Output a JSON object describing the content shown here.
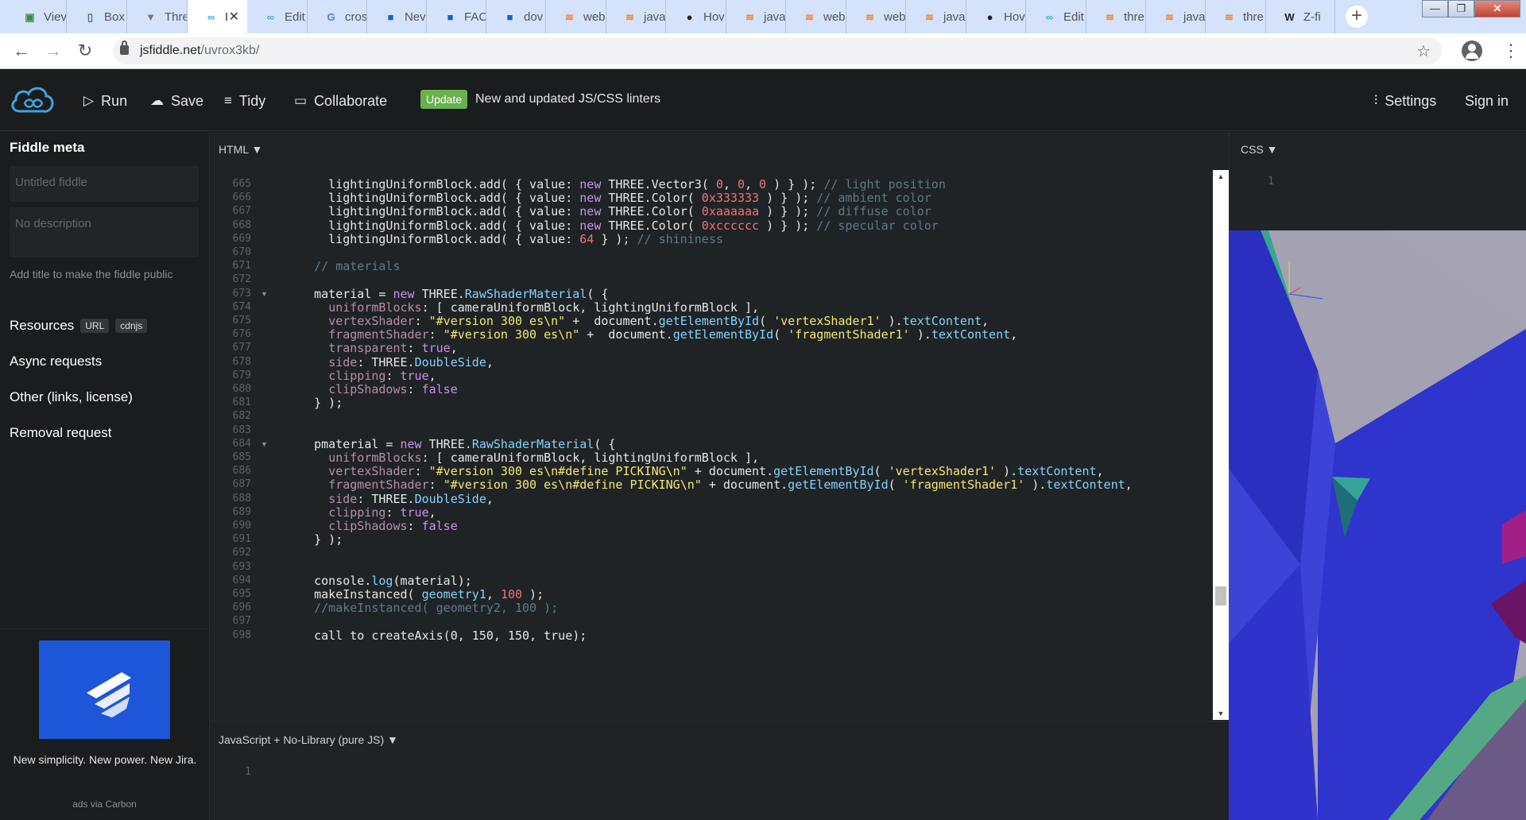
{
  "browser": {
    "tabs": [
      {
        "label": "Viev",
        "icon": "tab-app-icon"
      },
      {
        "label": "Box",
        "icon": "tab-doc-icon"
      },
      {
        "label": "Thre",
        "icon": "tab-triangle-icon"
      },
      {
        "label": "I",
        "icon": "tab-jsfiddle-icon",
        "active": true
      },
      {
        "label": "Edit",
        "icon": "tab-jsfiddle-icon"
      },
      {
        "label": "cros",
        "icon": "tab-google-icon"
      },
      {
        "label": "Nev",
        "icon": "tab-blue-icon"
      },
      {
        "label": "FAC",
        "icon": "tab-blue-icon"
      },
      {
        "label": "dov",
        "icon": "tab-blue-icon"
      },
      {
        "label": "web",
        "icon": "tab-stackoverflow-icon"
      },
      {
        "label": "java",
        "icon": "tab-stackoverflow-icon"
      },
      {
        "label": "Hov",
        "icon": "tab-github-icon"
      },
      {
        "label": "java",
        "icon": "tab-stackoverflow-icon"
      },
      {
        "label": "web",
        "icon": "tab-stackoverflow-icon"
      },
      {
        "label": "web",
        "icon": "tab-stackoverflow-icon"
      },
      {
        "label": "java",
        "icon": "tab-stackoverflow-icon"
      },
      {
        "label": "Hov",
        "icon": "tab-github-icon"
      },
      {
        "label": "Edit",
        "icon": "tab-jsfiddle-icon"
      },
      {
        "label": "thre",
        "icon": "tab-stackoverflow-icon"
      },
      {
        "label": "java",
        "icon": "tab-stackoverflow-icon"
      },
      {
        "label": "thre",
        "icon": "tab-stackoverflow-icon"
      },
      {
        "label": "Z-fi",
        "icon": "tab-wikipedia-icon"
      }
    ],
    "url_domain": "jsfiddle.net",
    "url_path": "/uvrox3kb/"
  },
  "header": {
    "run": "Run",
    "save": "Save",
    "tidy": "Tidy",
    "collaborate": "Collaborate",
    "update_badge": "Update",
    "update_text": "New and updated JS/CSS linters",
    "settings": "Settings",
    "sign_in": "Sign in"
  },
  "sidebar": {
    "title": "Fiddle meta",
    "title_placeholder": "Untitled fiddle",
    "description_placeholder": "No description",
    "hint": "Add title to make the fiddle public",
    "resources": "Resources",
    "resource_badges": [
      "URL",
      "cdnjs"
    ],
    "async": "Async requests",
    "other": "Other (links, license)",
    "removal": "Removal request",
    "ad_text": "New simplicity. New power. New Jira.",
    "ad_via": "ads via Carbon"
  },
  "html_panel": {
    "label": "HTML ▼",
    "first_line": 665,
    "folds": [
      673,
      684
    ],
    "lines": [
      [
        [
          "      lightingUniformBlock.add( { value: ",
          "p"
        ],
        [
          "new ",
          "k"
        ],
        [
          "THREE.Vector3( ",
          "p"
        ],
        [
          "0",
          "n"
        ],
        [
          ", ",
          "p"
        ],
        [
          "0",
          "n"
        ],
        [
          ", ",
          "p"
        ],
        [
          "0",
          "n"
        ],
        [
          " ) } ); ",
          "p"
        ],
        [
          "// light position",
          "c"
        ]
      ],
      [
        [
          "      lightingUniformBlock.add( { value: ",
          "p"
        ],
        [
          "new ",
          "k"
        ],
        [
          "THREE.Color( ",
          "p"
        ],
        [
          "0x333333",
          "n"
        ],
        [
          " ) } ); ",
          "p"
        ],
        [
          "// ambient color",
          "c"
        ]
      ],
      [
        [
          "      lightingUniformBlock.add( { value: ",
          "p"
        ],
        [
          "new ",
          "k"
        ],
        [
          "THREE.Color( ",
          "p"
        ],
        [
          "0xaaaaaa",
          "n"
        ],
        [
          " ) } ); ",
          "p"
        ],
        [
          "// diffuse color",
          "c"
        ]
      ],
      [
        [
          "      lightingUniformBlock.add( { value: ",
          "p"
        ],
        [
          "new ",
          "k"
        ],
        [
          "THREE.Color( ",
          "p"
        ],
        [
          "0xcccccc",
          "n"
        ],
        [
          " ) } ); ",
          "p"
        ],
        [
          "// specular color",
          "c"
        ]
      ],
      [
        [
          "      lightingUniformBlock.add( { value: ",
          "p"
        ],
        [
          "64",
          "n"
        ],
        [
          " } ); ",
          "p"
        ],
        [
          "// shininess",
          "c"
        ]
      ],
      [],
      [
        [
          "    // materials",
          "c"
        ]
      ],
      [],
      [
        [
          "    material = ",
          "p"
        ],
        [
          "new ",
          "k"
        ],
        [
          "THREE.",
          "p"
        ],
        [
          "RawShaderMaterial",
          "f"
        ],
        [
          "( {",
          "p"
        ]
      ],
      [
        [
          "      ",
          "p"
        ],
        [
          "uniformBlocks",
          "b"
        ],
        [
          ": [ cameraUniformBlock, lightingUniformBlock ],",
          "p"
        ]
      ],
      [
        [
          "      ",
          "p"
        ],
        [
          "vertexShader",
          "b"
        ],
        [
          ": ",
          "p"
        ],
        [
          "\"#version 300 es\\n\"",
          "s"
        ],
        [
          " +  document.",
          "p"
        ],
        [
          "getElementById",
          "f"
        ],
        [
          "( ",
          "p"
        ],
        [
          "'vertexShader1'",
          "s"
        ],
        [
          " ).",
          "p"
        ],
        [
          "textContent",
          "f"
        ],
        [
          ",",
          "p"
        ]
      ],
      [
        [
          "      ",
          "p"
        ],
        [
          "fragmentShader",
          "b"
        ],
        [
          ": ",
          "p"
        ],
        [
          "\"#version 300 es\\n\"",
          "s"
        ],
        [
          " +  document.",
          "p"
        ],
        [
          "getElementById",
          "f"
        ],
        [
          "( ",
          "p"
        ],
        [
          "'fragmentShader1'",
          "s"
        ],
        [
          " ).",
          "p"
        ],
        [
          "textContent",
          "f"
        ],
        [
          ",",
          "p"
        ]
      ],
      [
        [
          "      ",
          "p"
        ],
        [
          "transparent",
          "b"
        ],
        [
          ": ",
          "p"
        ],
        [
          "true",
          "k"
        ],
        [
          ",",
          "p"
        ]
      ],
      [
        [
          "      ",
          "p"
        ],
        [
          "side",
          "b"
        ],
        [
          ": THREE.",
          "p"
        ],
        [
          "DoubleSide",
          "f"
        ],
        [
          ",",
          "p"
        ]
      ],
      [
        [
          "      ",
          "p"
        ],
        [
          "clipping",
          "b"
        ],
        [
          ": ",
          "p"
        ],
        [
          "true",
          "k"
        ],
        [
          ",",
          "p"
        ]
      ],
      [
        [
          "      ",
          "p"
        ],
        [
          "clipShadows",
          "b"
        ],
        [
          ": ",
          "p"
        ],
        [
          "false",
          "k"
        ]
      ],
      [
        [
          "    } );",
          "p"
        ]
      ],
      [],
      [],
      [
        [
          "    pmaterial = ",
          "p"
        ],
        [
          "new ",
          "k"
        ],
        [
          "THREE.",
          "p"
        ],
        [
          "RawShaderMaterial",
          "f"
        ],
        [
          "( {",
          "p"
        ]
      ],
      [
        [
          "      ",
          "p"
        ],
        [
          "uniformBlocks",
          "b"
        ],
        [
          ": [ cameraUniformBlock, lightingUniformBlock ],",
          "p"
        ]
      ],
      [
        [
          "      ",
          "p"
        ],
        [
          "vertexShader",
          "b"
        ],
        [
          ": ",
          "p"
        ],
        [
          "\"#version 300 es\\n#define PICKING\\n\"",
          "s"
        ],
        [
          " + document.",
          "p"
        ],
        [
          "getElementById",
          "f"
        ],
        [
          "( ",
          "p"
        ],
        [
          "'vertexShader1'",
          "s"
        ],
        [
          " ).",
          "p"
        ],
        [
          "textContent",
          "f"
        ],
        [
          ",",
          "p"
        ]
      ],
      [
        [
          "      ",
          "p"
        ],
        [
          "fragmentShader",
          "b"
        ],
        [
          ": ",
          "p"
        ],
        [
          "\"#version 300 es\\n#define PICKING\\n\"",
          "s"
        ],
        [
          " + document.",
          "p"
        ],
        [
          "getElementById",
          "f"
        ],
        [
          "( ",
          "p"
        ],
        [
          "'fragmentShader1'",
          "s"
        ],
        [
          " ).",
          "p"
        ],
        [
          "textContent",
          "f"
        ],
        [
          ",",
          "p"
        ]
      ],
      [
        [
          "      ",
          "p"
        ],
        [
          "side",
          "b"
        ],
        [
          ": THREE.",
          "p"
        ],
        [
          "DoubleSide",
          "f"
        ],
        [
          ",",
          "p"
        ]
      ],
      [
        [
          "      ",
          "p"
        ],
        [
          "clipping",
          "b"
        ],
        [
          ": ",
          "p"
        ],
        [
          "true",
          "k"
        ],
        [
          ",",
          "p"
        ]
      ],
      [
        [
          "      ",
          "p"
        ],
        [
          "clipShadows",
          "b"
        ],
        [
          ": ",
          "p"
        ],
        [
          "false",
          "k"
        ]
      ],
      [
        [
          "    } );",
          "p"
        ]
      ],
      [],
      [],
      [
        [
          "    console.",
          "p"
        ],
        [
          "log",
          "f"
        ],
        [
          "(material);",
          "p"
        ]
      ],
      [
        [
          "    makeInstanced( ",
          "p"
        ],
        [
          "geometry1",
          "f"
        ],
        [
          ", ",
          "p"
        ],
        [
          "100",
          "n"
        ],
        [
          " );",
          "p"
        ]
      ],
      [
        [
          "    //makeInstanced( geometry2, 100 );",
          "c"
        ]
      ],
      [],
      [
        [
          "    ",
          "p"
        ],
        [
          "call to createAxis(0, 150, 150, true);",
          "p"
        ]
      ]
    ]
  },
  "js_panel": {
    "label": "JavaScript + No-Library (pure JS) ▼",
    "line": "1"
  },
  "css_panel": {
    "label": "CSS ▼",
    "line": "1"
  },
  "colors": {
    "editor_bg": "#202325",
    "header_bg": "#1a1c1d",
    "accent_update": "#6ab04c",
    "ad_blue": "#1e56d9"
  }
}
